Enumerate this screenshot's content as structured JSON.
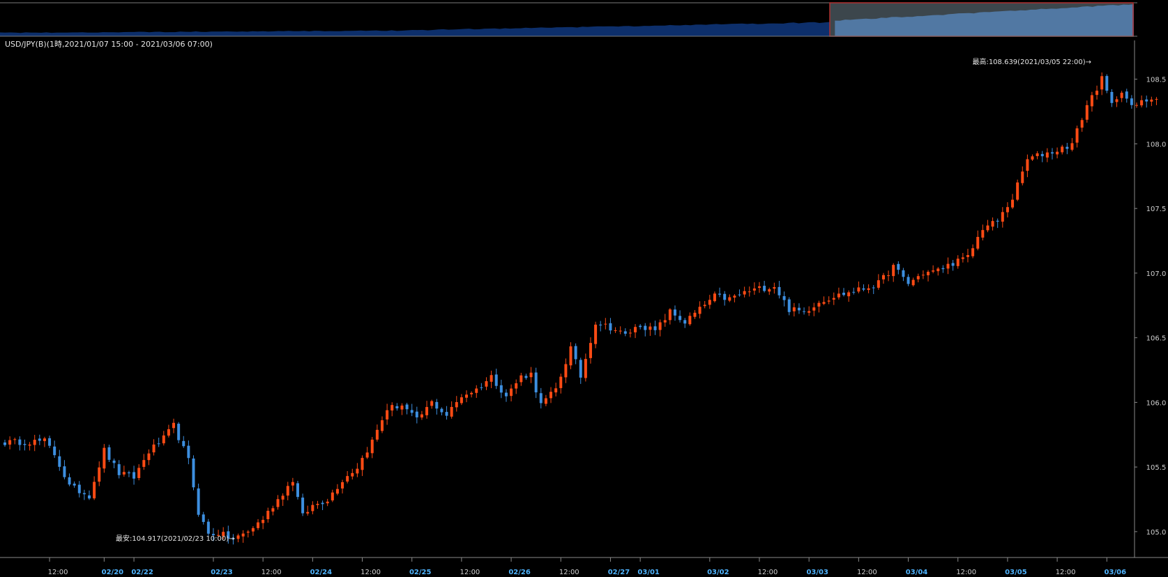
{
  "header": {
    "title": "USD/JPY(B)(1時,2021/01/07 15:00 - 2021/03/06 07:00)"
  },
  "annotations": {
    "high": "最高:108.639(2021/03/05 22:00)→",
    "low": "最安:104.917(2021/02/23 10:00)→"
  },
  "colors": {
    "background": "#000000",
    "up": "#ff4b14",
    "down": "#3d8fe0",
    "axis": "#8a8a8a",
    "tick_text": "#cfcfcf",
    "date_text": "#4fb4ff",
    "nav_fill_dim": "#0d2f6b",
    "nav_fill_bright": "#2f6fc0",
    "nav_window": "#6d7f8a",
    "nav_border": "#b03030"
  },
  "chart_data": {
    "type": "candlestick",
    "title": "USD/JPY(B)(1時,2021/01/07 15:00 - 2021/03/06 07:00)",
    "xlabel": "",
    "ylabel": "",
    "ylim": [
      104.8,
      108.8
    ],
    "y_ticks": [
      "105.0",
      "105.5",
      "106.0",
      "106.5",
      "107.0",
      "107.5",
      "108.0",
      "108.5"
    ],
    "y_tick_values": [
      105.0,
      105.5,
      106.0,
      106.5,
      107.0,
      107.5,
      108.0,
      108.5
    ],
    "x_ticks": [
      {
        "label": "12:00",
        "index": 9,
        "date": false
      },
      {
        "label": "02/20",
        "index": 20,
        "date": true
      },
      {
        "label": "02/22",
        "index": 26,
        "date": true
      },
      {
        "label": "02/23",
        "index": 42,
        "date": true
      },
      {
        "label": "12:00",
        "index": 52,
        "date": false
      },
      {
        "label": "02/24",
        "index": 62,
        "date": true
      },
      {
        "label": "12:00",
        "index": 72,
        "date": false
      },
      {
        "label": "02/25",
        "index": 82,
        "date": true
      },
      {
        "label": "12:00",
        "index": 92,
        "date": false
      },
      {
        "label": "02/26",
        "index": 102,
        "date": true
      },
      {
        "label": "12:00",
        "index": 112,
        "date": false
      },
      {
        "label": "02/27",
        "index": 122,
        "date": true
      },
      {
        "label": "03/01",
        "index": 128,
        "date": true
      },
      {
        "label": "03/02",
        "index": 142,
        "date": true
      },
      {
        "label": "12:00",
        "index": 152,
        "date": false
      },
      {
        "label": "03/03",
        "index": 162,
        "date": true
      },
      {
        "label": "12:00",
        "index": 172,
        "date": false
      },
      {
        "label": "03/04",
        "index": 182,
        "date": true
      },
      {
        "label": "12:00",
        "index": 192,
        "date": false
      },
      {
        "label": "03/05",
        "index": 202,
        "date": true
      },
      {
        "label": "12:00",
        "index": 212,
        "date": false
      },
      {
        "label": "03/06",
        "index": 222,
        "date": true
      }
    ],
    "total_slots": 228,
    "close_path": [
      [
        0,
        105.69
      ],
      [
        8,
        105.7
      ],
      [
        10,
        105.6
      ],
      [
        13,
        105.35
      ],
      [
        17,
        105.28
      ],
      [
        20,
        105.63
      ],
      [
        23,
        105.45
      ],
      [
        26,
        105.42
      ],
      [
        29,
        105.62
      ],
      [
        32,
        105.72
      ],
      [
        34,
        105.82
      ],
      [
        37,
        105.55
      ],
      [
        39,
        105.15
      ],
      [
        41,
        104.98
      ],
      [
        43,
        104.99
      ],
      [
        46,
        104.94
      ],
      [
        49,
        105.0
      ],
      [
        52,
        105.1
      ],
      [
        55,
        105.25
      ],
      [
        58,
        105.4
      ],
      [
        60,
        105.12
      ],
      [
        62,
        105.2
      ],
      [
        65,
        105.25
      ],
      [
        68,
        105.4
      ],
      [
        71,
        105.5
      ],
      [
        74,
        105.7
      ],
      [
        77,
        105.95
      ],
      [
        80,
        105.98
      ],
      [
        83,
        105.86
      ],
      [
        86,
        106.0
      ],
      [
        89,
        105.9
      ],
      [
        92,
        106.05
      ],
      [
        95,
        106.1
      ],
      [
        98,
        106.2
      ],
      [
        101,
        106.05
      ],
      [
        104,
        106.2
      ],
      [
        106,
        106.22
      ],
      [
        108,
        105.98
      ],
      [
        111,
        106.1
      ],
      [
        114,
        106.42
      ],
      [
        116,
        106.2
      ],
      [
        119,
        106.62
      ],
      [
        122,
        106.58
      ],
      [
        125,
        106.52
      ],
      [
        128,
        106.6
      ],
      [
        131,
        106.55
      ],
      [
        134,
        106.7
      ],
      [
        137,
        106.62
      ],
      [
        140,
        106.72
      ],
      [
        143,
        106.82
      ],
      [
        146,
        106.8
      ],
      [
        149,
        106.85
      ],
      [
        152,
        106.88
      ],
      [
        155,
        106.9
      ],
      [
        158,
        106.72
      ],
      [
        161,
        106.7
      ],
      [
        164,
        106.78
      ],
      [
        167,
        106.82
      ],
      [
        170,
        106.85
      ],
      [
        173,
        106.88
      ],
      [
        176,
        106.92
      ],
      [
        179,
        107.05
      ],
      [
        182,
        106.92
      ],
      [
        185,
        107.0
      ],
      [
        188,
        107.02
      ],
      [
        191,
        107.08
      ],
      [
        194,
        107.12
      ],
      [
        197,
        107.35
      ],
      [
        200,
        107.4
      ],
      [
        203,
        107.58
      ],
      [
        206,
        107.88
      ],
      [
        209,
        107.92
      ],
      [
        212,
        107.95
      ],
      [
        215,
        108.0
      ],
      [
        218,
        108.3
      ],
      [
        221,
        108.5
      ],
      [
        223,
        108.3
      ],
      [
        225,
        108.42
      ],
      [
        227,
        108.28
      ],
      [
        229,
        108.32
      ],
      [
        232,
        108.37
      ]
    ]
  }
}
